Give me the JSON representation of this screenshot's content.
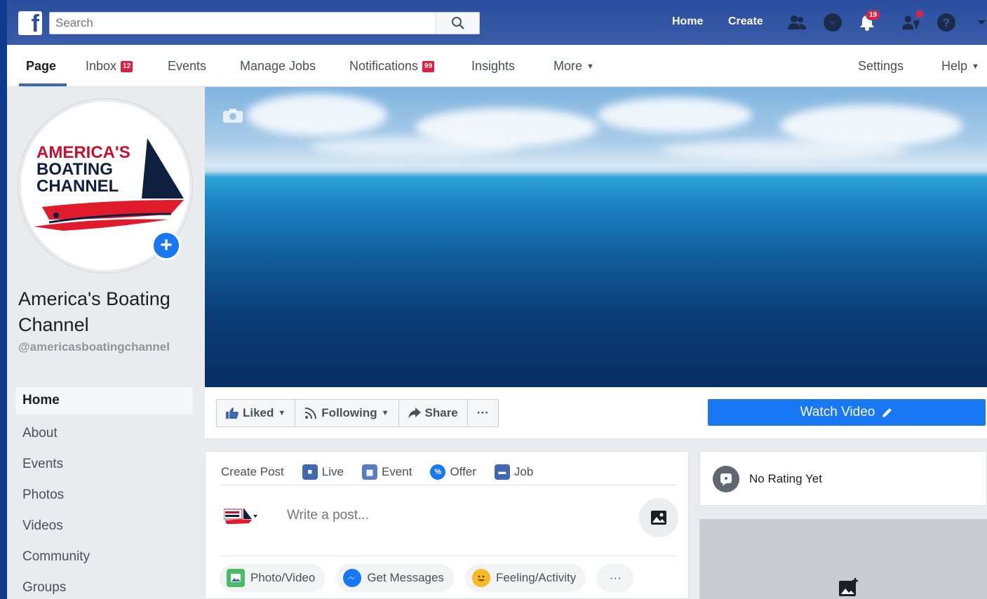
{
  "topbar": {
    "logo": "f",
    "search_placeholder": "Search",
    "home_label": "Home",
    "create_label": "Create",
    "notifications_count": "19",
    "colors": {
      "bar": "#3a5ba8",
      "badge": "#e41e3f"
    }
  },
  "pagenav": {
    "items": [
      {
        "label": "Page"
      },
      {
        "label": "Inbox",
        "badge": "12"
      },
      {
        "label": "Events"
      },
      {
        "label": "Manage Jobs"
      },
      {
        "label": "Notifications",
        "badge": "99"
      },
      {
        "label": "Insights"
      },
      {
        "label": "More"
      }
    ],
    "settings_label": "Settings",
    "help_label": "Help"
  },
  "profile": {
    "logo_lines": [
      "AMERICA'S",
      "BOATING",
      "CHANNEL"
    ],
    "name": "America's Boating Channel",
    "handle": "@americasboatingchannel"
  },
  "sidebar": {
    "items": [
      {
        "label": "Home"
      },
      {
        "label": "About"
      },
      {
        "label": "Events"
      },
      {
        "label": "Photos"
      },
      {
        "label": "Videos"
      },
      {
        "label": "Community"
      },
      {
        "label": "Groups"
      }
    ]
  },
  "actions": {
    "liked": "Liked",
    "following": "Following",
    "share": "Share",
    "more": "···",
    "watch_video": "Watch Video",
    "accent": "#1877f2"
  },
  "composer": {
    "tabs": [
      "Create Post",
      "Live",
      "Event",
      "Offer",
      "Job"
    ],
    "placeholder": "Write a post...",
    "pills": [
      "Photo/Video",
      "Get Messages",
      "Feeling/Activity"
    ],
    "more": "···"
  },
  "rating": {
    "text": "No Rating Yet"
  }
}
